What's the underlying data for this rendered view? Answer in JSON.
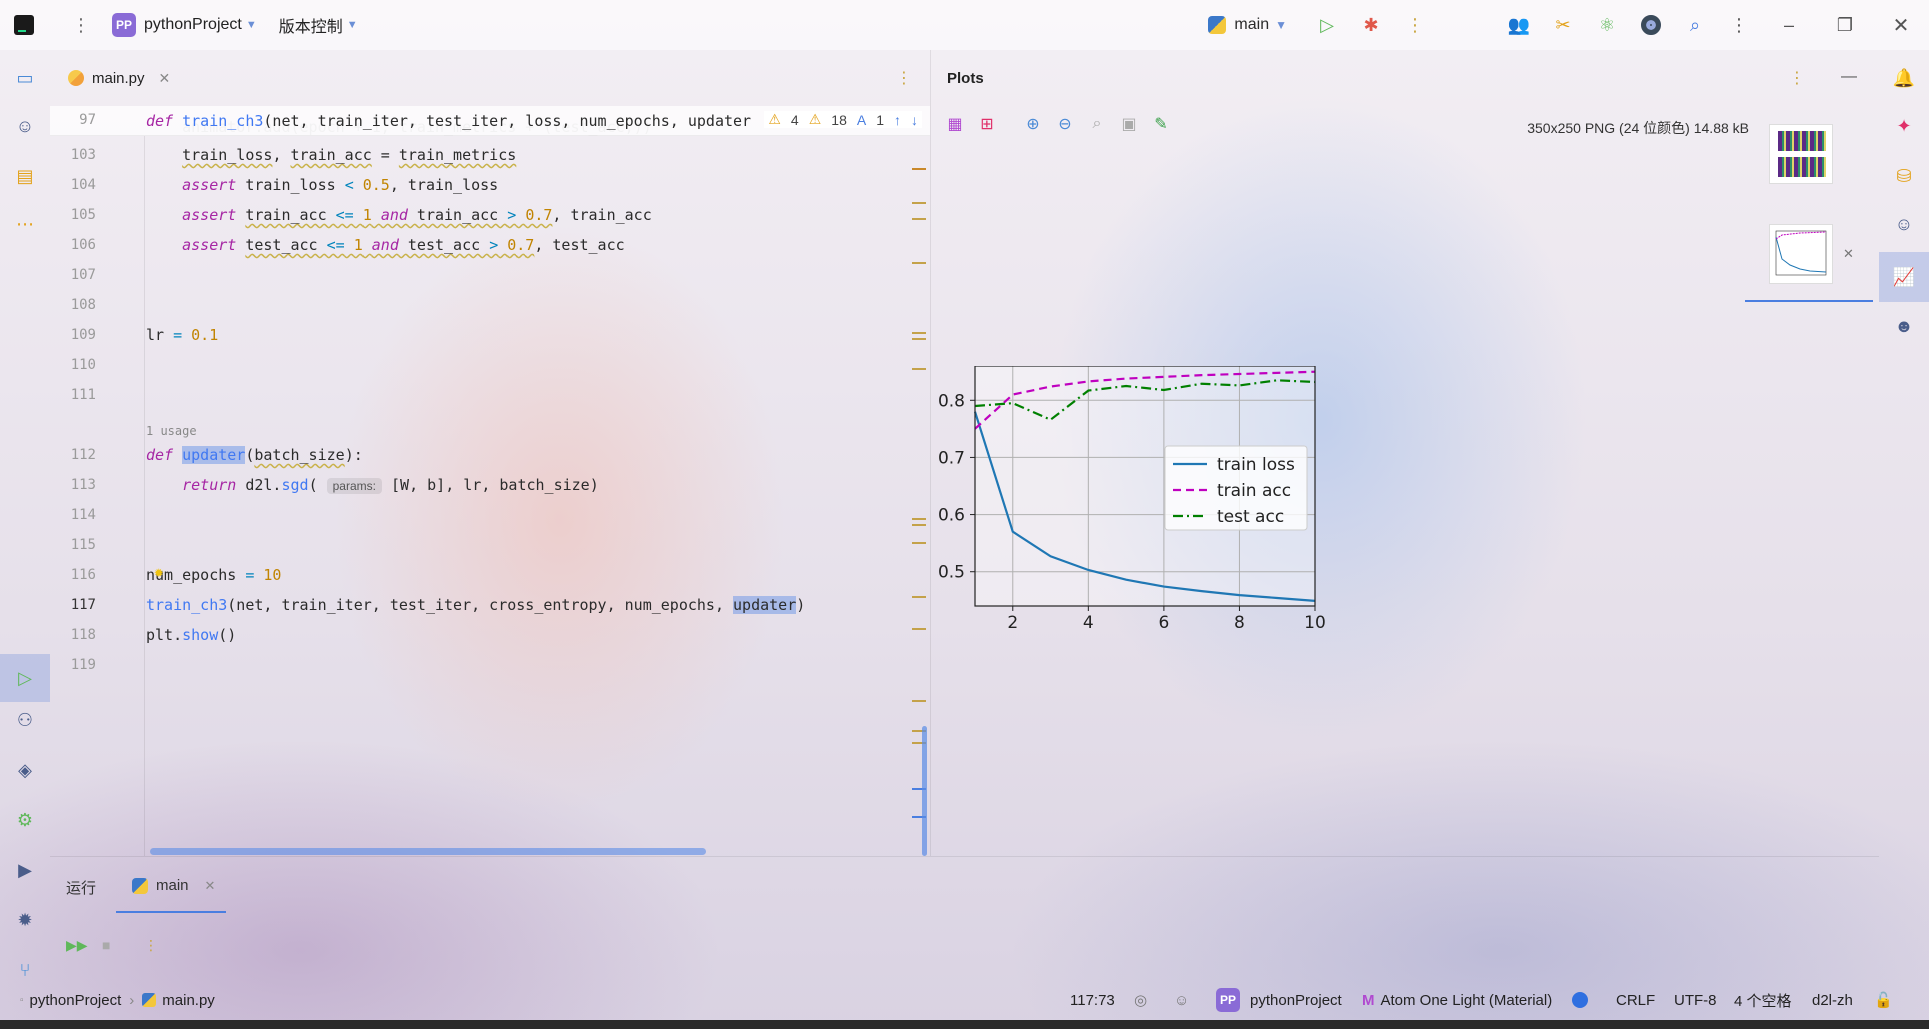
{
  "titlebar": {
    "project_badge": "PP",
    "project_name": "pythonProject",
    "vcs_label": "版本控制",
    "run_config": "main"
  },
  "editor": {
    "tab_label": "main.py",
    "sticky": {
      "line_number": "97",
      "warnings": "4",
      "weak_warnings": "18",
      "typos": "1"
    },
    "usage_hint": "1 usage",
    "param_hint": "params:",
    "line_numbers": [
      "103",
      "104",
      "105",
      "106",
      "107",
      "108",
      "109",
      "110",
      "111",
      "112",
      "113",
      "114",
      "115",
      "116",
      "117",
      "118",
      "119"
    ]
  },
  "plots": {
    "title": "Plots",
    "image_info": "350x250 PNG (24 位颜色) 14.88 kB"
  },
  "chart_data": {
    "type": "line",
    "x": [
      1,
      2,
      3,
      4,
      5,
      6,
      7,
      8,
      9,
      10
    ],
    "xlim": [
      1,
      10
    ],
    "ylim": [
      0.44,
      0.86
    ],
    "xticks": [
      "2",
      "4",
      "6",
      "8",
      "10"
    ],
    "yticks": [
      "0.5",
      "0.6",
      "0.7",
      "0.8"
    ],
    "grid": true,
    "legend_position": "center-right",
    "series": [
      {
        "name": "train loss",
        "color": "#1f77b4",
        "dash": "solid",
        "values": [
          0.78,
          0.57,
          0.527,
          0.503,
          0.486,
          0.474,
          0.466,
          0.459,
          0.454,
          0.449
        ]
      },
      {
        "name": "train acc",
        "color": "#bf00bf",
        "dash": "dashed",
        "values": [
          0.75,
          0.81,
          0.824,
          0.833,
          0.838,
          0.841,
          0.844,
          0.846,
          0.848,
          0.85
        ]
      },
      {
        "name": "test acc",
        "color": "#008000",
        "dash": "dashdot",
        "values": [
          0.79,
          0.795,
          0.766,
          0.817,
          0.825,
          0.818,
          0.829,
          0.826,
          0.835,
          0.832
        ]
      }
    ]
  },
  "run": {
    "label": "运行",
    "tab_label": "main"
  },
  "status": {
    "project": "pythonProject",
    "file": "main.py",
    "position": "117:73",
    "theme": "Atom One Light (Material)",
    "line_ending": "CRLF",
    "encoding": "UTF-8",
    "indent": "4 个空格",
    "interpreter": "d2l-zh"
  },
  "icons": {
    "logo": "pycharm-logo-icon",
    "run": "run-triangle-icon",
    "debug": "debug-bug-icon"
  },
  "colors": {
    "accent": "#4a7ee0",
    "badge": "#8a6bd6",
    "run_green": "#5fb85a"
  }
}
